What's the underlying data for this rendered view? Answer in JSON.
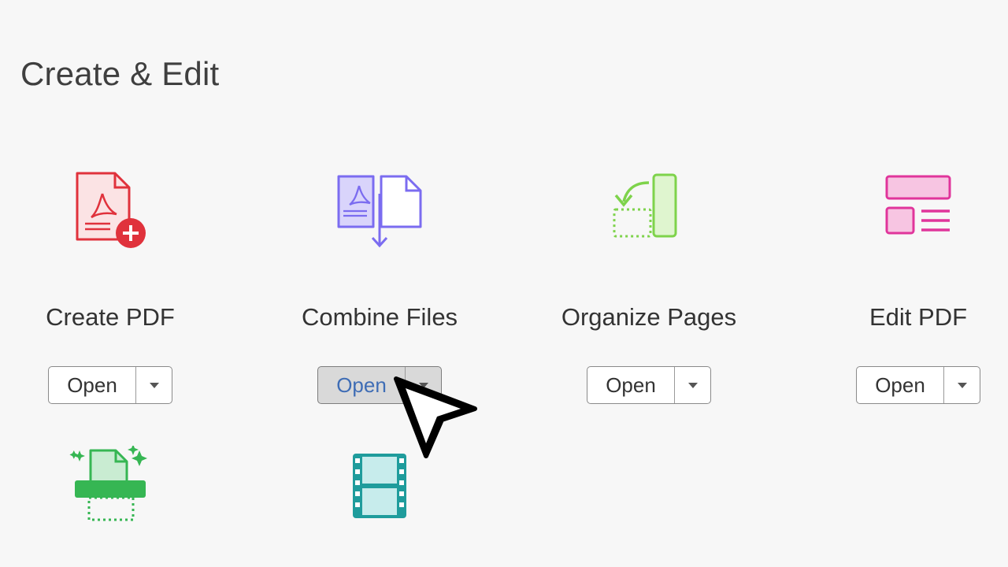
{
  "section": {
    "title": "Create & Edit"
  },
  "tools": [
    {
      "label": "Create PDF",
      "open_label": "Open",
      "icon": "create-pdf-icon",
      "color": "#e0323c"
    },
    {
      "label": "Combine Files",
      "open_label": "Open",
      "icon": "combine-files-icon",
      "color": "#7b6cf0",
      "hovered": true
    },
    {
      "label": "Organize Pages",
      "open_label": "Open",
      "icon": "organize-pages-icon",
      "color": "#7ed34b"
    },
    {
      "label": "Edit PDF",
      "open_label": "Open",
      "icon": "edit-pdf-icon",
      "color": "#e0359b"
    },
    {
      "icon": "scan-icon",
      "color": "#36b653"
    },
    {
      "icon": "rich-media-icon",
      "color": "#1f9c9c"
    }
  ],
  "colors": {
    "accent": "#3f6db5",
    "background": "#f7f7f7"
  }
}
